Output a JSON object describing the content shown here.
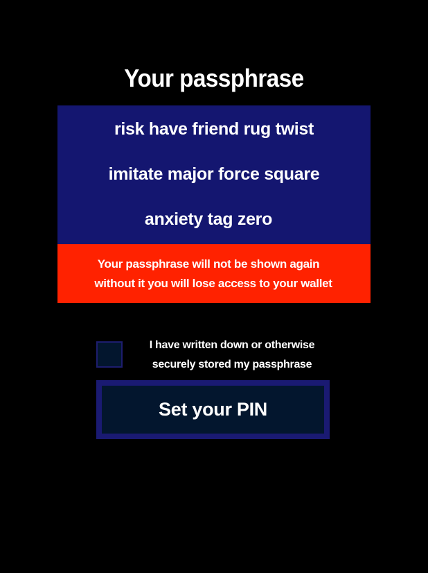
{
  "title": "Your passphrase",
  "passphrase": {
    "lines": [
      "risk have friend rug twist",
      "imitate major force square",
      "anxiety tag zero"
    ]
  },
  "warning": {
    "lines": [
      "Your passphrase will not be shown again",
      "without it you will lose access to your wallet"
    ]
  },
  "confirmation": {
    "checked": false,
    "lines": [
      "I have written down or otherwise",
      "securely stored my passphrase"
    ]
  },
  "pin_button": {
    "label": "Set your PIN"
  },
  "colors": {
    "background": "#000000",
    "passphrase_box": "#141670",
    "warning_box": "#ff2200",
    "button_fill": "#03162e",
    "button_border": "#1a1a72",
    "text": "#ffffff"
  }
}
